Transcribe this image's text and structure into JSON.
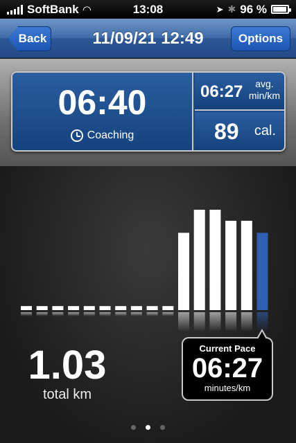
{
  "status_bar": {
    "carrier": "SoftBank",
    "time": "13:08",
    "battery": "96 %",
    "battery_level": 0.96
  },
  "nav": {
    "back_label": "Back",
    "title": "11/09/21 12:49",
    "options_label": "Options"
  },
  "stats": {
    "duration": "06:40",
    "coaching_label": "Coaching",
    "avg_pace": "06:27",
    "avg_unit_line1": "avg.",
    "avg_unit_line2": "min/km",
    "calories": "89",
    "calories_unit": "cal."
  },
  "summary": {
    "distance": "1.03",
    "distance_label": "total km"
  },
  "current_pace": {
    "title": "Current Pace",
    "value": "06:27",
    "unit": "minutes/km"
  },
  "page_indicator": {
    "count": 3,
    "active": 1
  },
  "colors": {
    "accent": "#2f5fb0",
    "bar": "#ffffff",
    "highlight_bar": "#2f5fb0"
  },
  "chart_data": {
    "type": "bar",
    "bars": [
      0.04,
      0.04,
      0.04,
      0.04,
      0.04,
      0.04,
      0.04,
      0.04,
      0.04,
      0.04,
      0.77,
      1.0,
      1.0,
      0.89,
      0.89,
      0.77
    ],
    "highlight_index": 15
  }
}
